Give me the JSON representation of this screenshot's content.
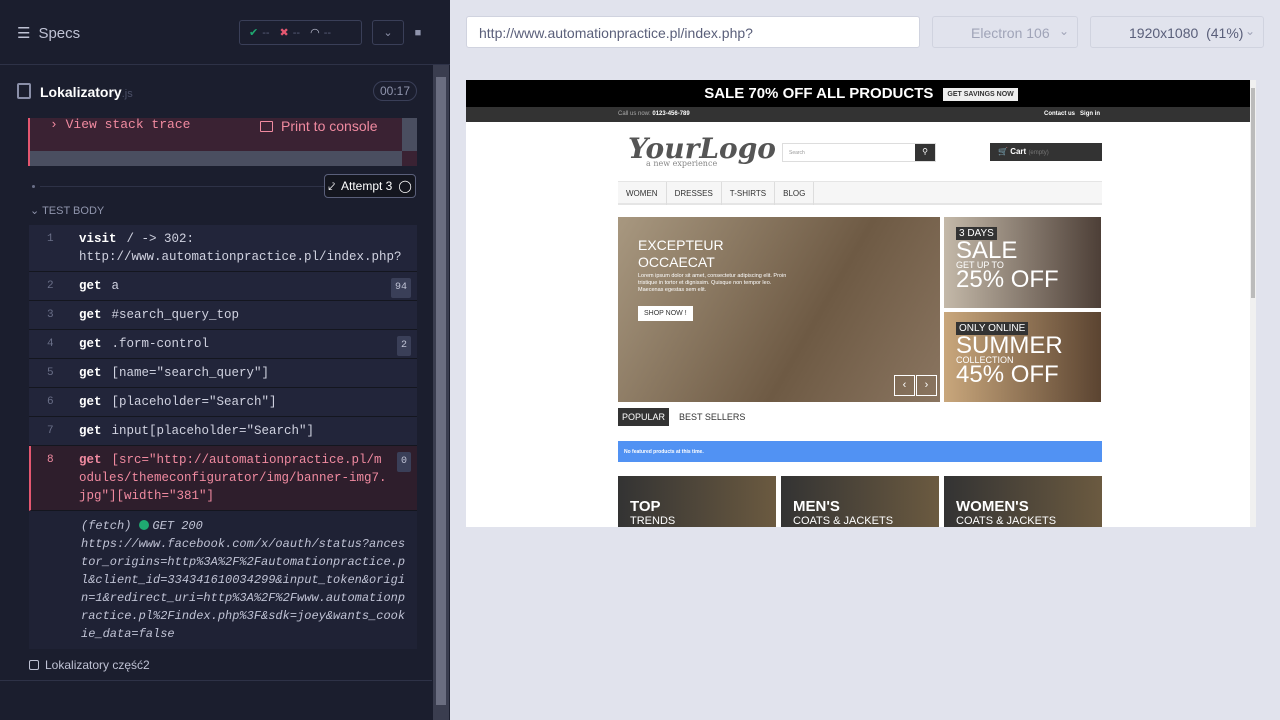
{
  "sidebar": {
    "title": "Specs",
    "stats": {
      "passed": "--",
      "failed": "--",
      "pending": "--"
    },
    "spec": {
      "name": "Lokalizatory",
      "ext": ".js",
      "time": "00:17"
    },
    "error": {
      "stack_label": "View stack trace",
      "console_label": "Print to console"
    },
    "attempt_label": "Attempt 3",
    "test_body_label": "TEST BODY",
    "commands": [
      {
        "num": "1",
        "name": "visit",
        "msg": "/ -> 302: http://www.automationpractice.pl/index.php?",
        "badge": ""
      },
      {
        "num": "2",
        "name": "get",
        "msg": "a",
        "badge": "94"
      },
      {
        "num": "3",
        "name": "get",
        "msg": "#search_query_top",
        "badge": ""
      },
      {
        "num": "4",
        "name": "get",
        "msg": ".form-control",
        "badge": "2"
      },
      {
        "num": "5",
        "name": "get",
        "msg": "[name=\"search_query\"]",
        "badge": ""
      },
      {
        "num": "6",
        "name": "get",
        "msg": "[placeholder=\"Search\"]",
        "badge": ""
      },
      {
        "num": "7",
        "name": "get",
        "msg": "input[placeholder=\"Search\"]",
        "badge": ""
      },
      {
        "num": "8",
        "name": "get",
        "msg": "[src=\"http://automationpractice.pl/modules/themeconfigurator/img/banner-img7.jpg\"][width=\"381\"]",
        "badge": "0"
      }
    ],
    "fetch": {
      "type": "(fetch)",
      "status": "GET 200",
      "url": "https://www.facebook.com/x/oauth/status?ancestor_origins=http%3A%2F%2Fautomationpractice.pl&client_id=334341610034299&input_token&origin=1&redirect_uri=http%3A%2F%2Fwww.automationpractice.pl%2Findex.php%3F&sdk=joey&wants_cookie_data=false"
    },
    "next_spec": "Lokalizatory część2"
  },
  "runner": {
    "url": "http://www.automationpractice.pl/index.php?",
    "browser": "Electron 106",
    "viewport": "1920x1080",
    "zoom": "(41%)"
  },
  "aut": {
    "promo": "SALE 70% OFF ALL PRODUCTS",
    "promo_cta": "GET SAVINGS NOW",
    "phone_label": "Call us now:",
    "phone": "0123-456-789",
    "contact": "Contact us",
    "signin": "Sign in",
    "logo": "YourLogo",
    "logo_tagline": "a new experience",
    "search_placeholder": "Search",
    "cart": "Cart",
    "cart_empty": "(empty)",
    "menu": [
      "WOMEN",
      "DRESSES",
      "T-SHIRTS",
      "BLOG"
    ],
    "slide_heading": "EXCEPTEUR OCCAECAT",
    "slide_text": "Lorem ipsum dolor sit amet, consectetur adipiscing elit. Proin tristique in tortor et dignissim. Quisque non tempor leo. Maecenas egestas sem elit.",
    "shop_now": "SHOP NOW !",
    "banner1_tag": "3 DAYS",
    "banner1_big": "SALE",
    "banner1_small": "GET UP TO",
    "banner1_off": "25% OFF",
    "banner2_tag": "ONLY ONLINE",
    "banner2_big": "SUMMER",
    "banner2_small": "COLLECTION",
    "banner2_off": "45% OFF",
    "tab_popular": "POPULAR",
    "tab_best": "BEST SELLERS",
    "alert": "No featured products at this time.",
    "cards": [
      {
        "title": "TOP",
        "sub": "TRENDS"
      },
      {
        "title": "MEN'S",
        "sub": "COATS & JACKETS"
      },
      {
        "title": "WOMEN'S",
        "sub": "COATS & JACKETS"
      }
    ]
  }
}
